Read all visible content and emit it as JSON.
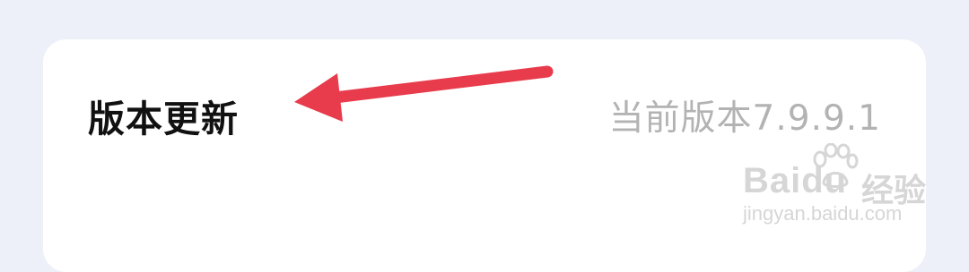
{
  "settings": {
    "row": {
      "title": "版本更新",
      "value": "当前版本7.9.9.1"
    }
  },
  "annotation": {
    "arrow_color": "#e83b4c"
  },
  "watermark": {
    "brand": "Baidu",
    "cn": "经验",
    "url": "jingyan.baidu.com"
  },
  "colors": {
    "background": "#edf0f8",
    "card": "#ffffff",
    "title": "#111111",
    "value": "#b3b3b3"
  }
}
